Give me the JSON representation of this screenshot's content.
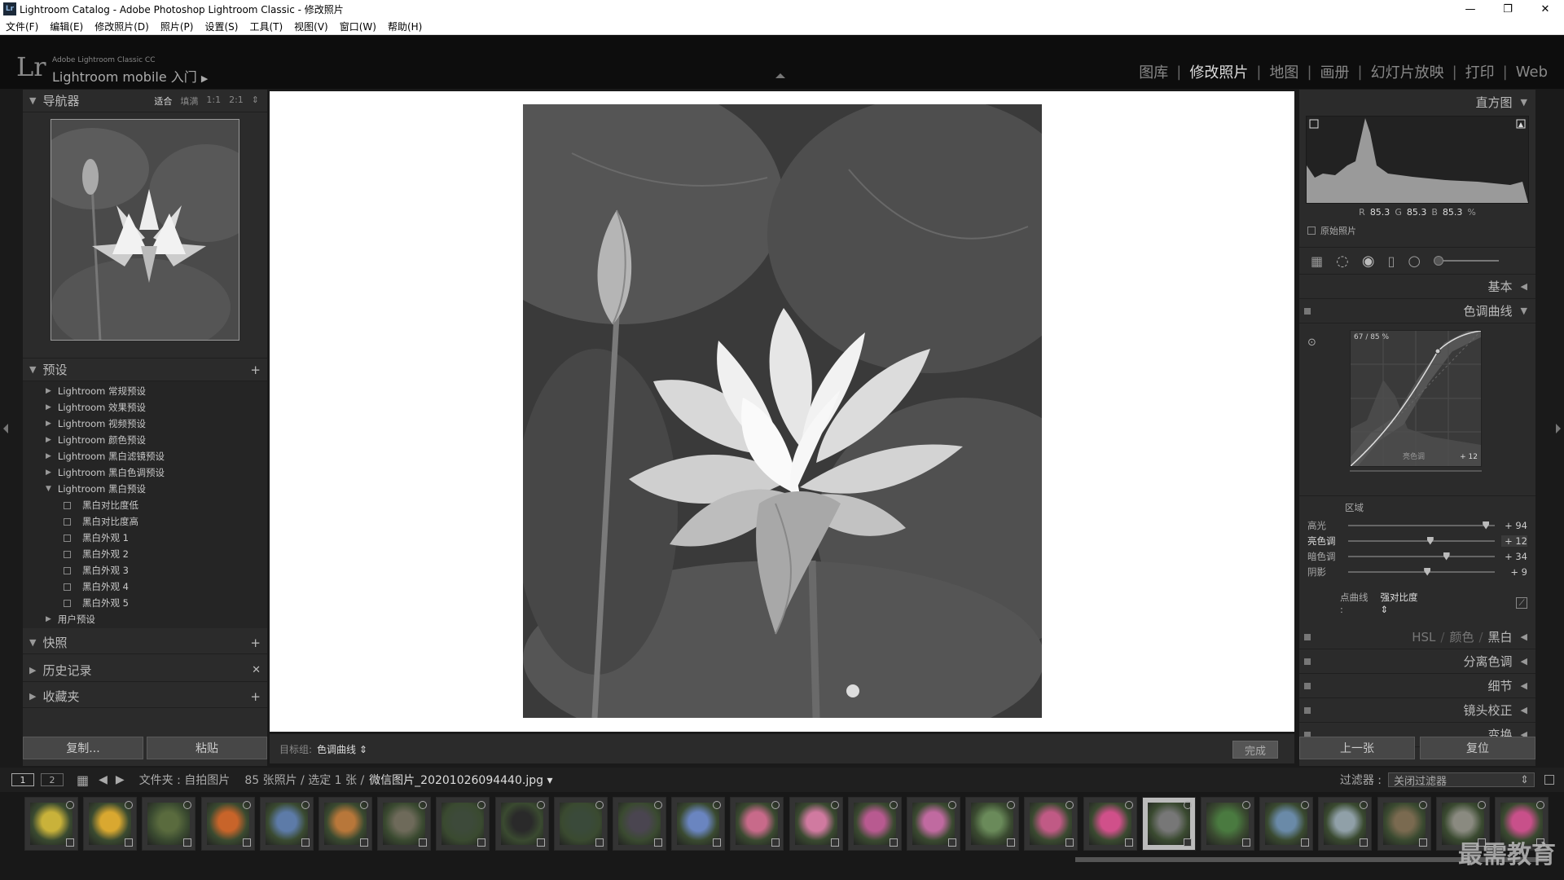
{
  "window": {
    "title": "Lightroom Catalog - Adobe Photoshop Lightroom Classic - 修改照片",
    "app_badge": "Lr"
  },
  "menu": [
    "文件(F)",
    "编辑(E)",
    "修改照片(D)",
    "照片(P)",
    "设置(S)",
    "工具(T)",
    "视图(V)",
    "窗口(W)",
    "帮助(H)"
  ],
  "identity": {
    "logo": "Lr",
    "product": "Adobe Lightroom Classic CC",
    "mobile": "Lightroom mobile 入门"
  },
  "modules": [
    "图库",
    "修改照片",
    "地图",
    "画册",
    "幻灯片放映",
    "打印",
    "Web"
  ],
  "navigator": {
    "title": "导航器",
    "options": [
      "适合",
      "填满",
      "1:1",
      "2:1"
    ]
  },
  "presets": {
    "title": "预设",
    "groups": [
      "Lightroom 常规预设",
      "Lightroom 效果预设",
      "Lightroom 视频预设",
      "Lightroom 颜色预设",
      "Lightroom 黑白滤镜预设",
      "Lightroom 黑白色调预设"
    ],
    "open_group": "Lightroom 黑白预设",
    "items": [
      "黑白对比度低",
      "黑白对比度高",
      "黑白外观 1",
      "黑白外观 2",
      "黑白外观 3",
      "黑白外观 4",
      "黑白外观 5"
    ],
    "user": "用户预设"
  },
  "snapshots": {
    "title": "快照"
  },
  "history": {
    "title": "历史记录"
  },
  "collections": {
    "title": "收藏夹"
  },
  "left_buttons": {
    "copy": "复制...",
    "paste": "粘贴"
  },
  "toolbar": {
    "target_label": "目标组:",
    "target_value": "色调曲线",
    "done": "完成"
  },
  "histogram": {
    "title": "直方图",
    "r": "85.3",
    "g": "85.3",
    "b": "85.3",
    "unit": "%",
    "r_label": "R",
    "g_label": "G",
    "b_label": "B",
    "original": "原始照片"
  },
  "sections": {
    "basic": "基本",
    "tone_curve": "色调曲线",
    "hsl": [
      "HSL",
      "颜色",
      "黑白"
    ],
    "split": "分离色调",
    "detail": "细节",
    "lens": "镜头校正",
    "transform": "变换"
  },
  "curve": {
    "readout": "67 / 85 %",
    "region_label": "亮色调",
    "region_value": "+ 12"
  },
  "regions": {
    "title": "区域",
    "rows": [
      {
        "name": "高光",
        "value": "+ 94",
        "pos": 0.94
      },
      {
        "name": "亮色调",
        "value": "+ 12",
        "pos": 0.56
      },
      {
        "name": "暗色调",
        "value": "+ 34",
        "pos": 0.67
      },
      {
        "name": "阴影",
        "value": "+ 9",
        "pos": 0.54
      }
    ]
  },
  "point_curve": {
    "label": "点曲线 :",
    "value": "强对比度"
  },
  "right_buttons": {
    "prev": "上一张",
    "reset": "复位"
  },
  "filmstrip_bar": {
    "view1": "1",
    "view2": "2",
    "path": "文件夹 : 自拍图片",
    "count": "85 张照片 / 选定 1 张 /",
    "file": "微信图片_20201026094440.jpg",
    "filter_label": "过滤器 :",
    "filter_value": "关闭过滤器"
  },
  "filmstrip": {
    "count": 26,
    "selected": 19
  },
  "watermark": "最需教育",
  "colors": {
    "accent": "#dddddd",
    "panel": "#2b2b2b"
  }
}
